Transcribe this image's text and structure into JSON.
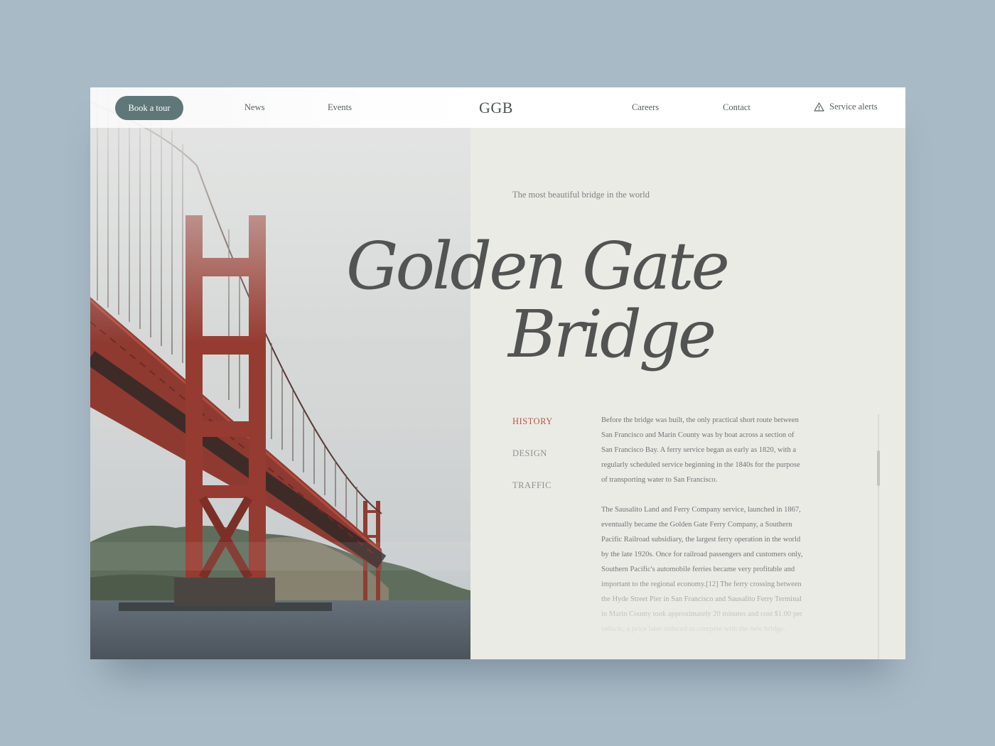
{
  "header": {
    "book_label": "Book a tour",
    "nav_left": [
      "News",
      "Events"
    ],
    "logo": "GGB",
    "nav_right": [
      "Careers",
      "Contact"
    ],
    "alerts_label": "Service alerts",
    "alerts_icon": "warning-triangle-icon"
  },
  "hero": {
    "tagline": "The most beautiful bridge in the world",
    "title_line1": "Golden Gate",
    "title_line2": "Bridge"
  },
  "tabs": [
    {
      "label": "HISTORY",
      "active": true
    },
    {
      "label": "DESIGN",
      "active": false
    },
    {
      "label": "TRAFFIC",
      "active": false
    }
  ],
  "article": {
    "p1": "Before the bridge was built, the only practical short route between San Francisco and Marin County was by boat across a section of San Francisco Bay. A ferry service began as early as 1820, with a regularly scheduled service beginning in the 1840s for the purpose of transporting water to San Francisco.",
    "p2": "The Sausalito Land and Ferry Company service, launched in 1867, eventually became the Golden Gate Ferry Company, a Southern Pacific Railroad subsidiary, the largest ferry operation in the world by the late 1920s. Once for railroad passengers and customers only, Southern Pacific's automobile ferries became very profitable and important to the regional economy.[12] The ferry crossing between the Hyde Street Pier in San Francisco and Sausalito Ferry Terminal in Marin County took approximately 20 minutes and cost $1.00 per vehicle, a price later reduced to compete with the new bridge."
  },
  "colors": {
    "page_bg": "#a8bac6",
    "panel_bg": "#ebebe6",
    "button_bg": "#5f7779",
    "active_tab": "#b0594a",
    "bridge_red": "#9a3a30"
  }
}
